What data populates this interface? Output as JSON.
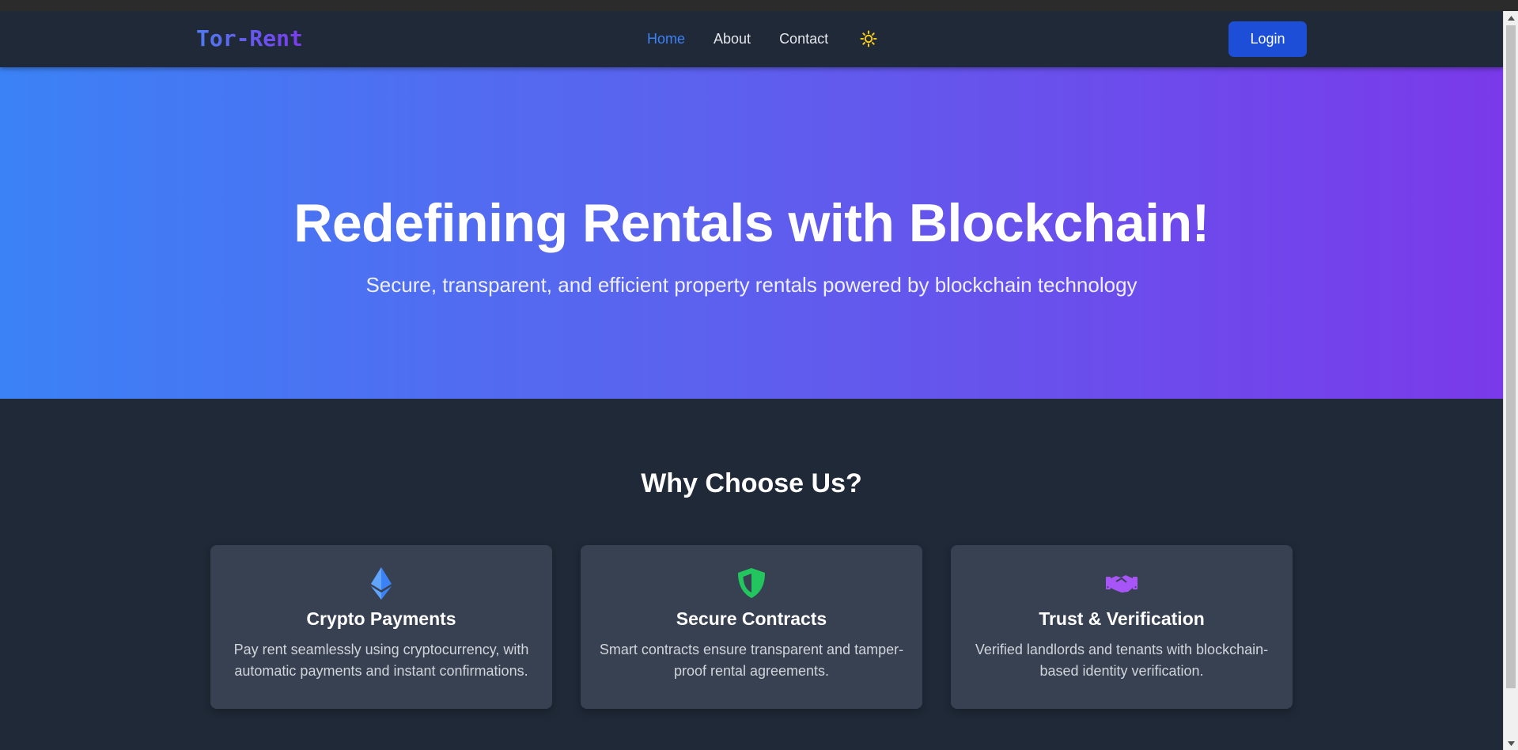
{
  "app": {
    "logo": "Tor-Rent"
  },
  "nav": {
    "items": [
      {
        "label": "Home",
        "active": true
      },
      {
        "label": "About",
        "active": false
      },
      {
        "label": "Contact",
        "active": false
      }
    ],
    "theme_icon": "sun-icon",
    "login_label": "Login"
  },
  "hero": {
    "title": "Redefining Rentals with Blockchain!",
    "subtitle": "Secure, transparent, and efficient property rentals powered by blockchain technology"
  },
  "why": {
    "title": "Why Choose Us?",
    "features": [
      {
        "icon": "ethereum-icon",
        "icon_color": "#3b82f6",
        "title": "Crypto Payments",
        "description": "Pay rent seamlessly using cryptocurrency, with automatic payments and instant confirmations."
      },
      {
        "icon": "shield-icon",
        "icon_color": "#22c55e",
        "title": "Secure Contracts",
        "description": "Smart contracts ensure transparent and tamper-proof rental agreements."
      },
      {
        "icon": "handshake-icon",
        "icon_color": "#a855f7",
        "title": "Trust & Verification",
        "description": "Verified landlords and tenants with blockchain-based identity verification."
      }
    ]
  },
  "colors": {
    "accent": "#3b82f6",
    "login_button": "#1d4ed8",
    "background": "#1f2937",
    "card": "#374151",
    "hero_gradient_start": "#3b82f6",
    "hero_gradient_end": "#7a3aea",
    "sun": "#facc15"
  }
}
